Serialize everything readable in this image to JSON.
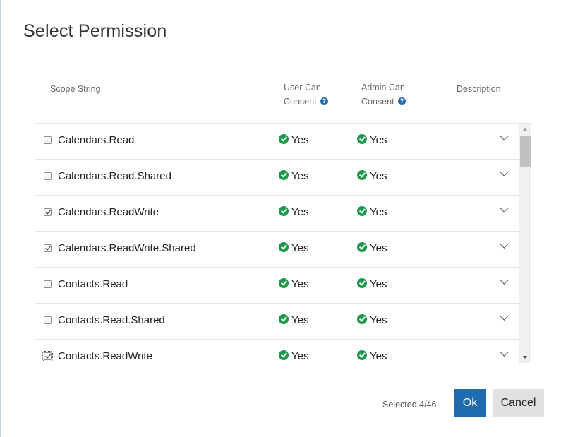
{
  "dialog": {
    "title": "Select Permission"
  },
  "columns": {
    "scope": "Scope String",
    "user_line1": "User Can",
    "user_line2": "Consent",
    "admin_line1": "Admin Can",
    "admin_line2": "Consent",
    "description": "Description",
    "help_icon_glyph": "?"
  },
  "rows": [
    {
      "scope": "Calendars.Read",
      "checked": false,
      "user": "Yes",
      "admin": "Yes"
    },
    {
      "scope": "Calendars.Read.Shared",
      "checked": false,
      "user": "Yes",
      "admin": "Yes"
    },
    {
      "scope": "Calendars.ReadWrite",
      "checked": true,
      "user": "Yes",
      "admin": "Yes"
    },
    {
      "scope": "Calendars.ReadWrite.Shared",
      "checked": true,
      "user": "Yes",
      "admin": "Yes"
    },
    {
      "scope": "Contacts.Read",
      "checked": false,
      "user": "Yes",
      "admin": "Yes"
    },
    {
      "scope": "Contacts.Read.Shared",
      "checked": false,
      "user": "Yes",
      "admin": "Yes"
    },
    {
      "scope": "Contacts.ReadWrite",
      "checked": true,
      "focused": true,
      "user": "Yes",
      "admin": "Yes"
    }
  ],
  "footer": {
    "selected_text": "Selected 4/46",
    "ok_label": "Ok",
    "cancel_label": "Cancel"
  },
  "colors": {
    "accent": "#1f6bb0",
    "success": "#1e9a4b",
    "cancel_bg": "#e1e1e1"
  },
  "icons": {
    "help": "help-circle-icon",
    "yes": "check-circle-icon",
    "expand": "chevron-down-icon"
  }
}
